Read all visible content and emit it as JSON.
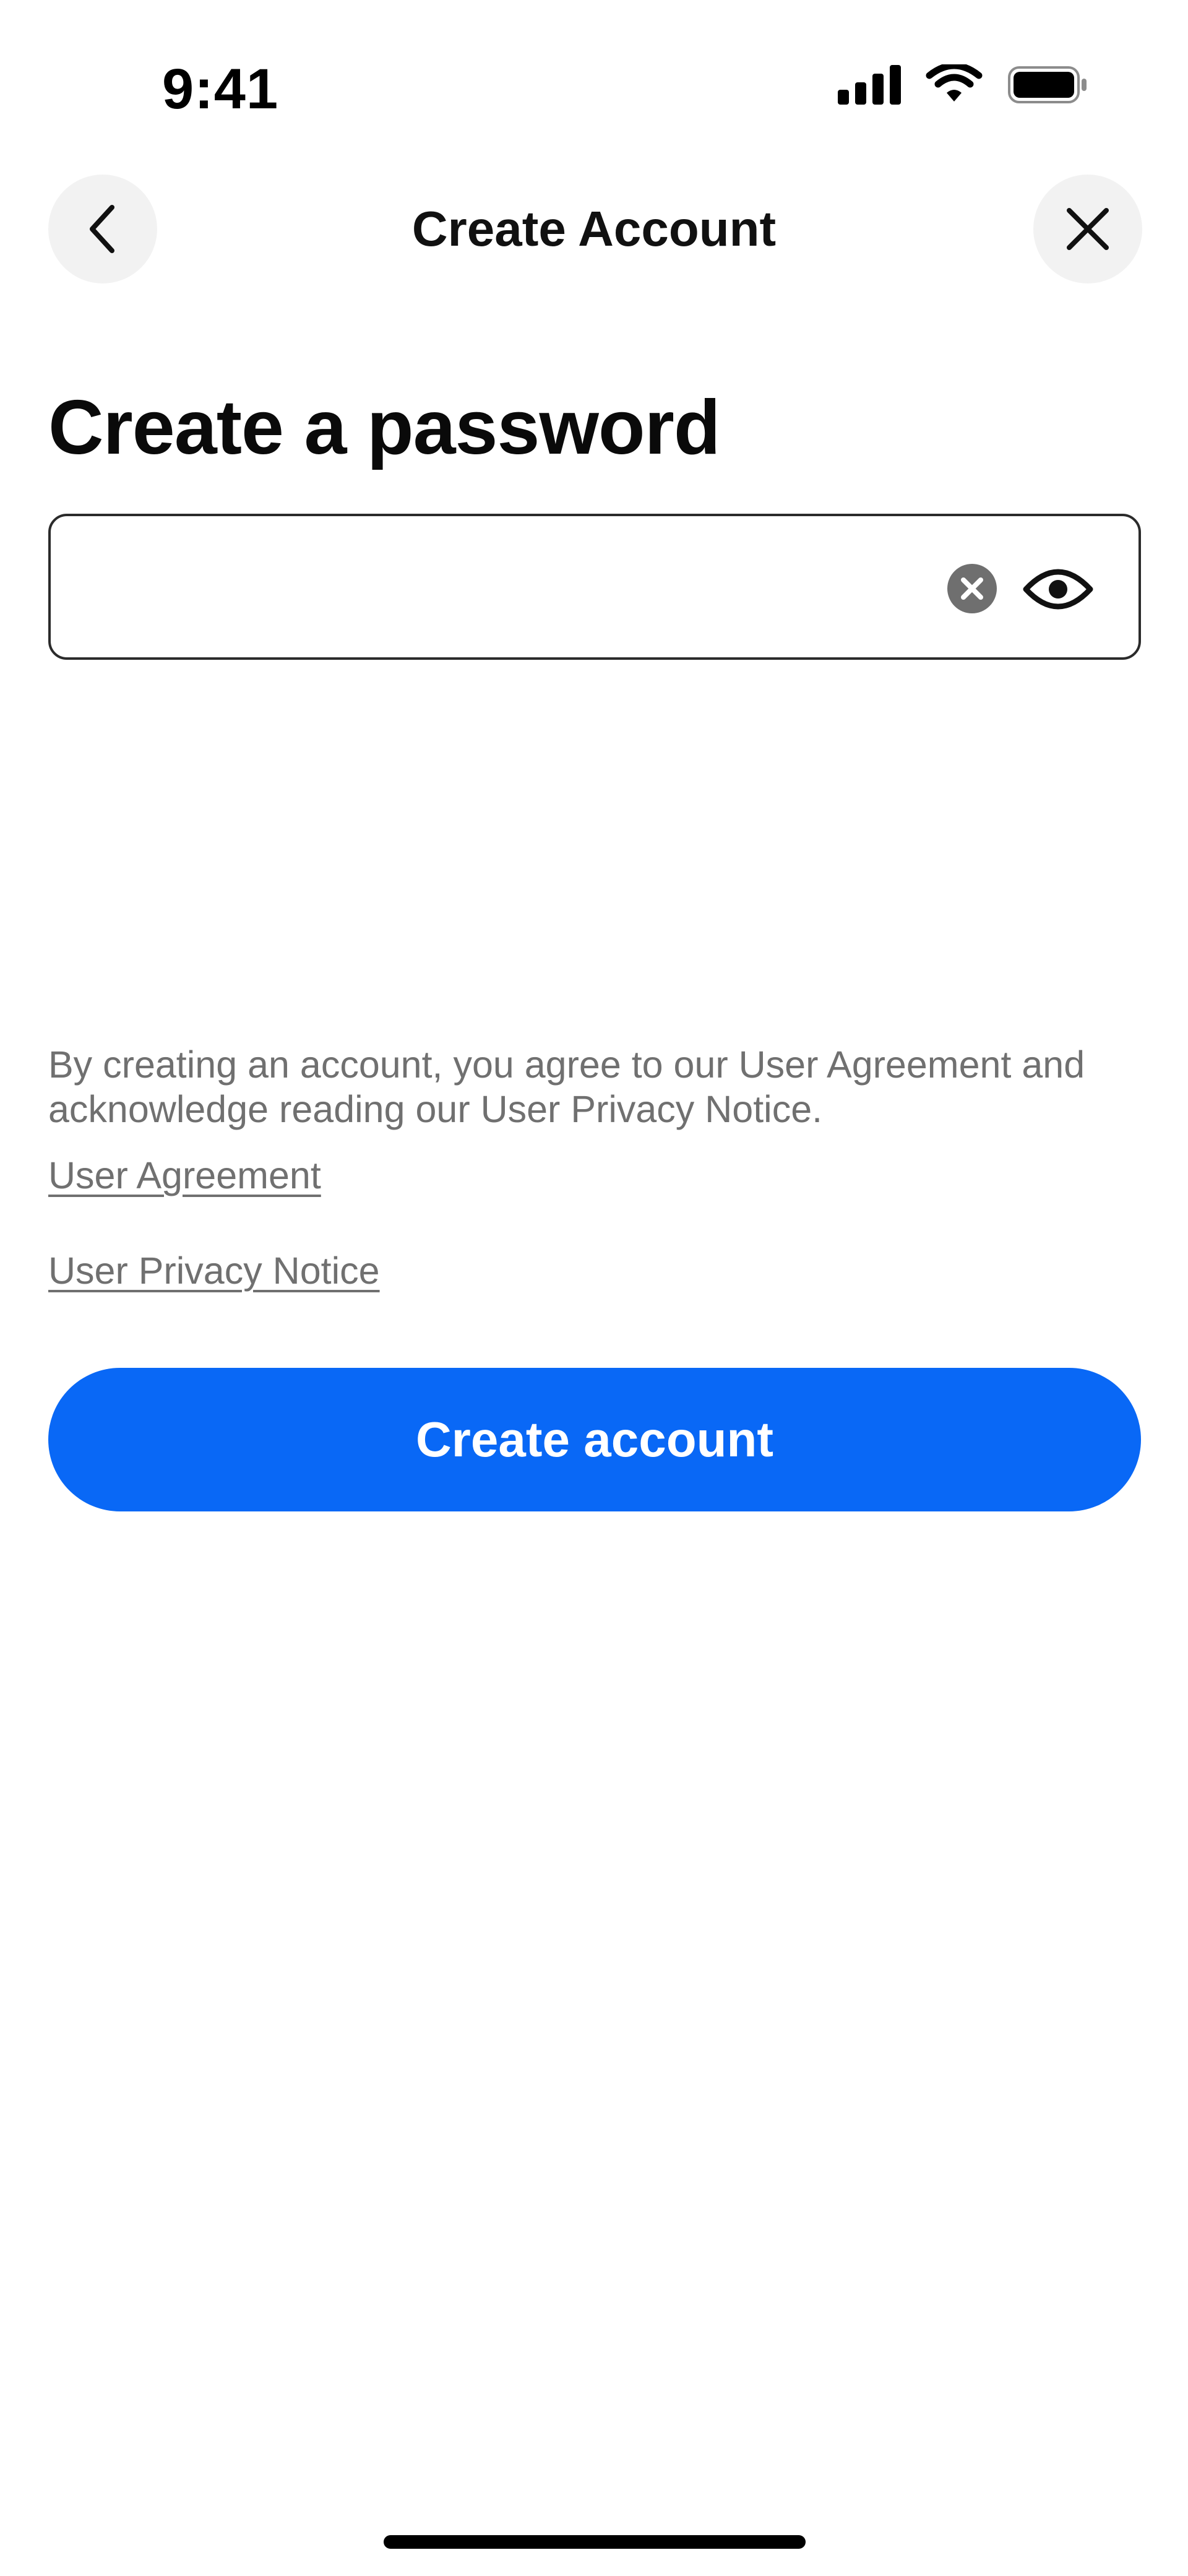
{
  "status_bar": {
    "time": "9:41",
    "icons": [
      "cellular-signal-icon",
      "wifi-icon",
      "battery-icon"
    ]
  },
  "nav": {
    "title": "Create Account",
    "back_icon": "chevron-left-icon",
    "close_icon": "close-icon"
  },
  "heading": "Create a password",
  "password_field": {
    "value": "",
    "placeholder": "",
    "clear_icon": "clear-circle-icon",
    "visibility_icon": "eye-icon"
  },
  "legal": {
    "text": "By creating an account, you agree to our User Agreement and acknowledge reading our User Privacy Notice.",
    "user_agreement_link": "User Agreement",
    "privacy_notice_link": "User Privacy Notice"
  },
  "primary_button": {
    "label": "Create account"
  },
  "colors": {
    "accent": "#0968f6",
    "text_primary": "#111111",
    "text_secondary": "#707070",
    "icon_button_bg": "#f2f2f2"
  }
}
